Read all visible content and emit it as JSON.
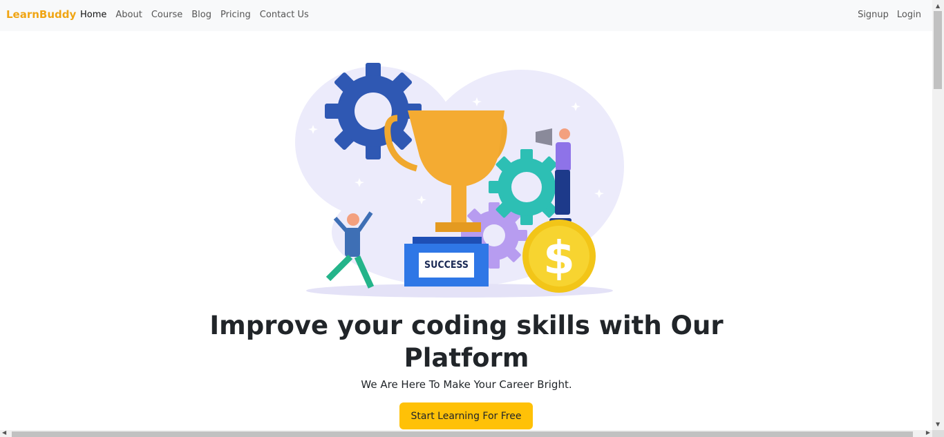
{
  "navbar": {
    "brand": "LearnBuddy",
    "links": [
      {
        "label": "Home",
        "active": true
      },
      {
        "label": "About"
      },
      {
        "label": "Course"
      },
      {
        "label": "Blog"
      },
      {
        "label": "Pricing"
      },
      {
        "label": "Contact Us"
      }
    ],
    "right_links": [
      {
        "label": "Signup"
      },
      {
        "label": "Login"
      }
    ]
  },
  "hero": {
    "illustration_label": "SUCCESS",
    "headline": "Improve your coding skills with Our Platform",
    "subline": "We Are Here To Make Your Career Bright.",
    "cta_label": "Start Learning For Free"
  },
  "colors": {
    "brand": "#f0a514",
    "cta": "#ffc107",
    "navbar_bg": "#f8f9fa"
  }
}
